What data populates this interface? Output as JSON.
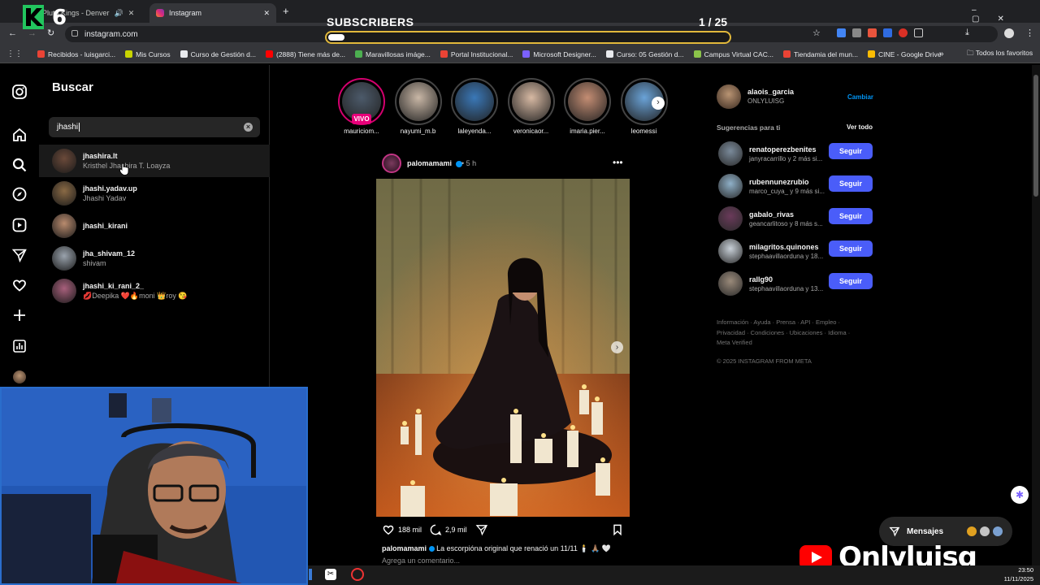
{
  "browser": {
    "tabs": [
      {
        "label": "cora Pluto Kings - Denver",
        "active": false
      },
      {
        "label": "Instagram",
        "active": true
      }
    ],
    "url": "instagram.com",
    "bookmarks": [
      {
        "label": "Recibidos - luisgarci...",
        "color": "#ea4335"
      },
      {
        "label": "Mis Cursos",
        "color": "#c8d400"
      },
      {
        "label": "Curso de Gestión d...",
        "color": "#e8eaed"
      },
      {
        "label": "(2888) Tiene más de...",
        "color": "#ff0000"
      },
      {
        "label": "Maravillosas imáge...",
        "color": "#4caf50"
      },
      {
        "label": "Portal Institucional...",
        "color": "#ea4335"
      },
      {
        "label": "Microsoft Designer...",
        "color": "#7b61ff"
      },
      {
        "label": "Curso: 05 Gestión d...",
        "color": "#e8eaed"
      },
      {
        "label": "Campus Virtual CAC...",
        "color": "#8bc34a"
      },
      {
        "label": "Tiendamia del mun...",
        "color": "#ea4335"
      },
      {
        "label": "CINE - Google Drive",
        "color": "#fbbc04"
      }
    ],
    "all_favorites": "Todos los favoritos"
  },
  "overlay": {
    "subscribers_label": "SUBSCRIBERS",
    "subscribers_count": "1  / 25",
    "progress": 0.04,
    "channel_name": "Onlyluisg"
  },
  "search": {
    "title": "Buscar",
    "query": "jhashi",
    "results": [
      {
        "username": "jhashira.lt",
        "fullname": "Kristhel Jhashira T. Loayza",
        "avatar": "#6b4a3a"
      },
      {
        "username": "jhashi.yadav.up",
        "fullname": "Jhashi Yadav",
        "avatar": "#8a6a45"
      },
      {
        "username": "jhashi_kirani",
        "fullname": "",
        "avatar": "#b98b6e"
      },
      {
        "username": "jha_shivam_12",
        "fullname": "shivam",
        "avatar": "#9aa3ad"
      },
      {
        "username": "jhashi_ki_rani_2_",
        "fullname": "💋Deepika ❤️🔥moni 👑roy 😘",
        "avatar": "#a8607c"
      }
    ]
  },
  "stories": [
    {
      "name": "mauriciom...",
      "live": true,
      "color": "#4c5a6a"
    },
    {
      "name": "nayumi_m.b",
      "live": false,
      "color": "#c9b7a6"
    },
    {
      "name": "laleyenda...",
      "live": false,
      "color": "#3a78b8"
    },
    {
      "name": "veronicaor...",
      "live": false,
      "color": "#d7b9a3"
    },
    {
      "name": "imaria.pier...",
      "live": false,
      "color": "#c48d73"
    },
    {
      "name": "leomessi",
      "live": false,
      "color": "#6aa3d8"
    }
  ],
  "live_badge": "VIVO",
  "post": {
    "author": "palomamami",
    "time": "5 h",
    "likes": "188 mil",
    "comments": "2,9 mil",
    "caption_author": "palomamami",
    "caption_text": "La escorpióna original que renació un 11/11 🕯️ 🙏🏽 🤍",
    "comment_placeholder": "Agrega un comentario..."
  },
  "profile": {
    "username": "alaois_garcia",
    "fullname": "ONLYLUISG",
    "switch_label": "Cambiar"
  },
  "suggestions": {
    "title": "Sugerencias para ti",
    "see_all": "Ver todo",
    "follow_label": "Seguir",
    "items": [
      {
        "username": "renatoperezbenites",
        "sub": "janyracarrillo y 2 más si...",
        "avatar": "#7a8a9a"
      },
      {
        "username": "rubennunezrubio",
        "sub": "marco_cuya_ y 9 más si...",
        "avatar": "#8fb0c8"
      },
      {
        "username": "gabalo_rivas",
        "sub": "geancarlitoso y 8 más s...",
        "avatar": "#6a3a5a"
      },
      {
        "username": "milagritos.quinones",
        "sub": "stephaavillaorduna y 18...",
        "avatar": "#c8d0d8"
      },
      {
        "username": "rallg90",
        "sub": "stephaavillaorduna y 13...",
        "avatar": "#9a8a7a"
      }
    ]
  },
  "footer": {
    "links": "Información · Ayuda · Prensa · API · Empleo · Privacidad · Condiciones · Ubicaciones · Idioma · Meta Verified",
    "copyright": "© 2025 INSTAGRAM FROM META"
  },
  "messages_label": "Mensajes",
  "clock": {
    "time": "23:50",
    "date": "11/11/2025"
  }
}
